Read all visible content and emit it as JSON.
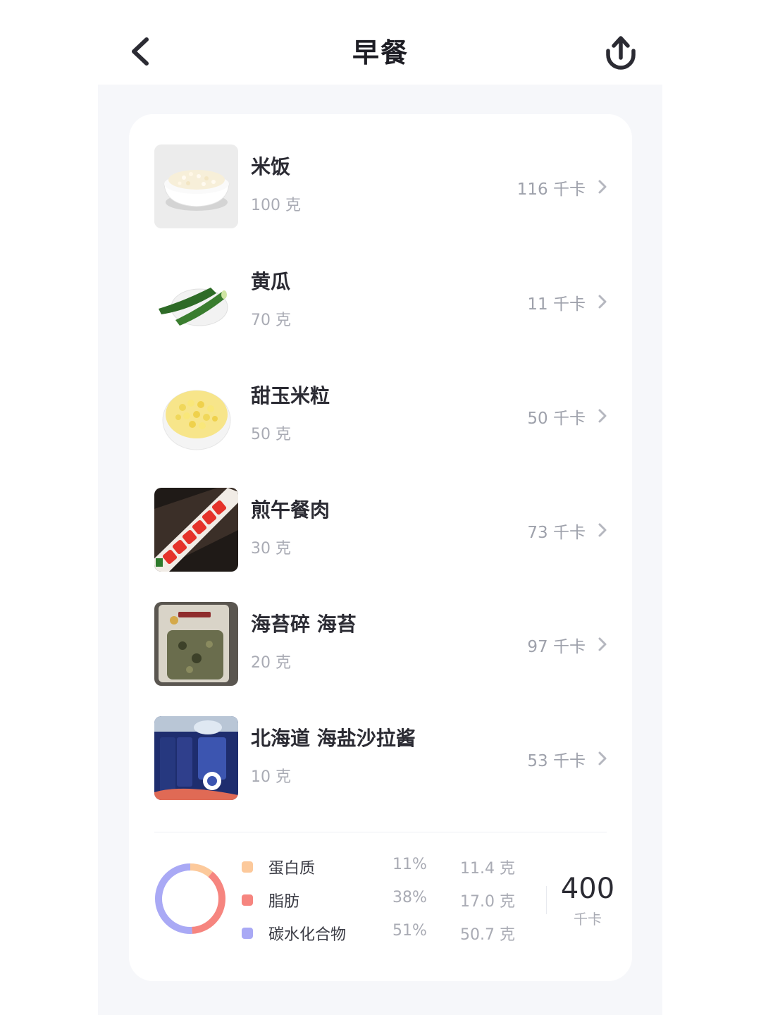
{
  "header": {
    "title": "早餐",
    "back_icon": "chevron-left-icon",
    "share_icon": "share-upload-icon"
  },
  "foods": [
    {
      "name": "米饭",
      "amount": "100 克",
      "kcal": "116 千卡",
      "image": "rice-bowl"
    },
    {
      "name": "黄瓜",
      "amount": "70 克",
      "kcal": "11 千卡",
      "image": "cucumber"
    },
    {
      "name": "甜玉米粒",
      "amount": "50 克",
      "kcal": "50 千卡",
      "image": "sweet-corn-bowl"
    },
    {
      "name": "煎午餐肉",
      "amount": "30 克",
      "kcal": "73 千卡",
      "image": "fried-luncheon-meat"
    },
    {
      "name": "海苔碎 海苔",
      "amount": "20 克",
      "kcal": "97 千卡",
      "image": "seaweed-package"
    },
    {
      "name": "北海道 海盐沙拉酱",
      "amount": "10 克",
      "kcal": "53 千卡",
      "image": "salad-dressing-package"
    }
  ],
  "nutrition": {
    "items": [
      {
        "label": "蛋白质",
        "percent": "11%",
        "grams": "11.4 克",
        "color": "#fcc99b",
        "fraction": 0.11
      },
      {
        "label": "脂肪",
        "percent": "38%",
        "grams": "17.0 克",
        "color": "#f6857f",
        "fraction": 0.38
      },
      {
        "label": "碳水化合物",
        "percent": "51%",
        "grams": "50.7 克",
        "color": "#a9a9f5",
        "fraction": 0.51
      }
    ],
    "total_kcal": "400",
    "total_unit": "千卡"
  },
  "colors": {
    "background": "#f6f7fa",
    "card": "#ffffff",
    "text_primary": "#2b2b33",
    "text_secondary": "#a9abb4"
  }
}
